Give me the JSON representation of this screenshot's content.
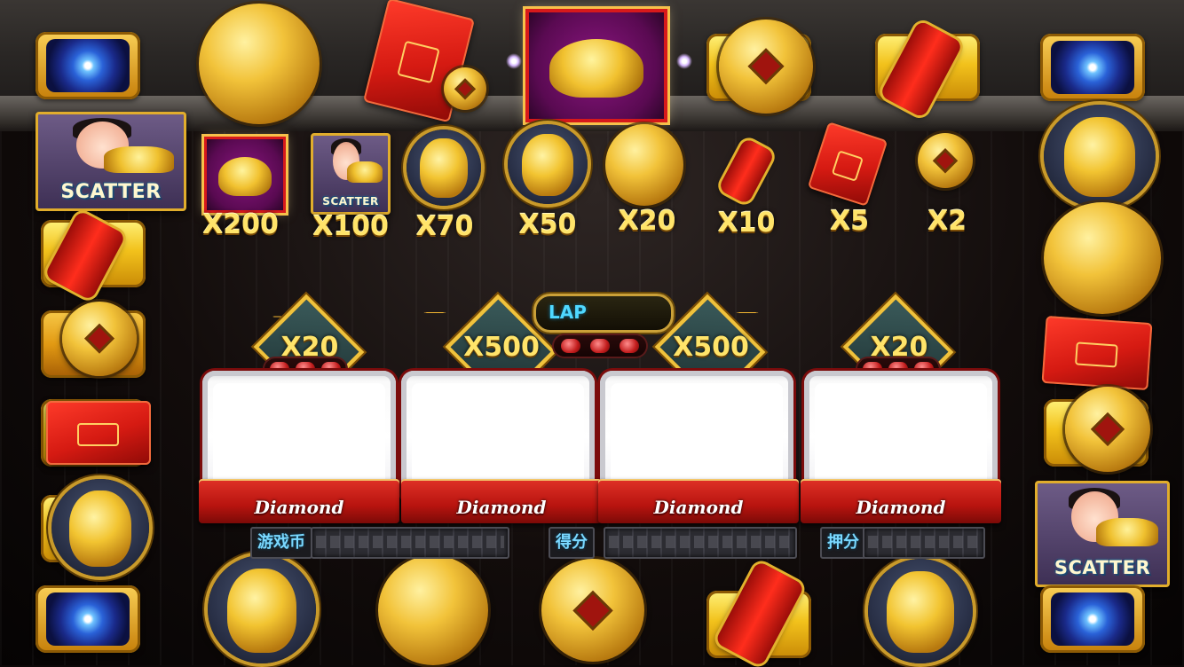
{
  "paytable": [
    {
      "symbol": "golden-toad",
      "multiplier": "X200"
    },
    {
      "symbol": "scatter-boy",
      "multiplier": "X100"
    },
    {
      "symbol": "laughing-buddha",
      "multiplier": "X70"
    },
    {
      "symbol": "ruyi-scepter",
      "multiplier": "X50"
    },
    {
      "symbol": "golden-carp",
      "multiplier": "X20"
    },
    {
      "symbol": "firecracker",
      "multiplier": "X10"
    },
    {
      "symbol": "red-envelope",
      "multiplier": "X5"
    },
    {
      "symbol": "copper-coin",
      "multiplier": "X2"
    }
  ],
  "scatter_label": "SCATTER",
  "lap": {
    "label": "LAP"
  },
  "badges": {
    "left": "X20",
    "center_left": "X500",
    "center_right": "X500",
    "right": "X20"
  },
  "reels": [
    {
      "label": "Diamond"
    },
    {
      "label": "Diamond"
    },
    {
      "label": "Diamond"
    },
    {
      "label": "Diamond"
    }
  ],
  "meters": {
    "credits_label": "游戏币",
    "win_label": "得分",
    "bet_label": "押分"
  },
  "colors": {
    "gold": "#ffe46a",
    "lap_text": "#4fd8ff",
    "ribbon_red": "#b8140f",
    "meter_label": "#7ad8ff"
  }
}
